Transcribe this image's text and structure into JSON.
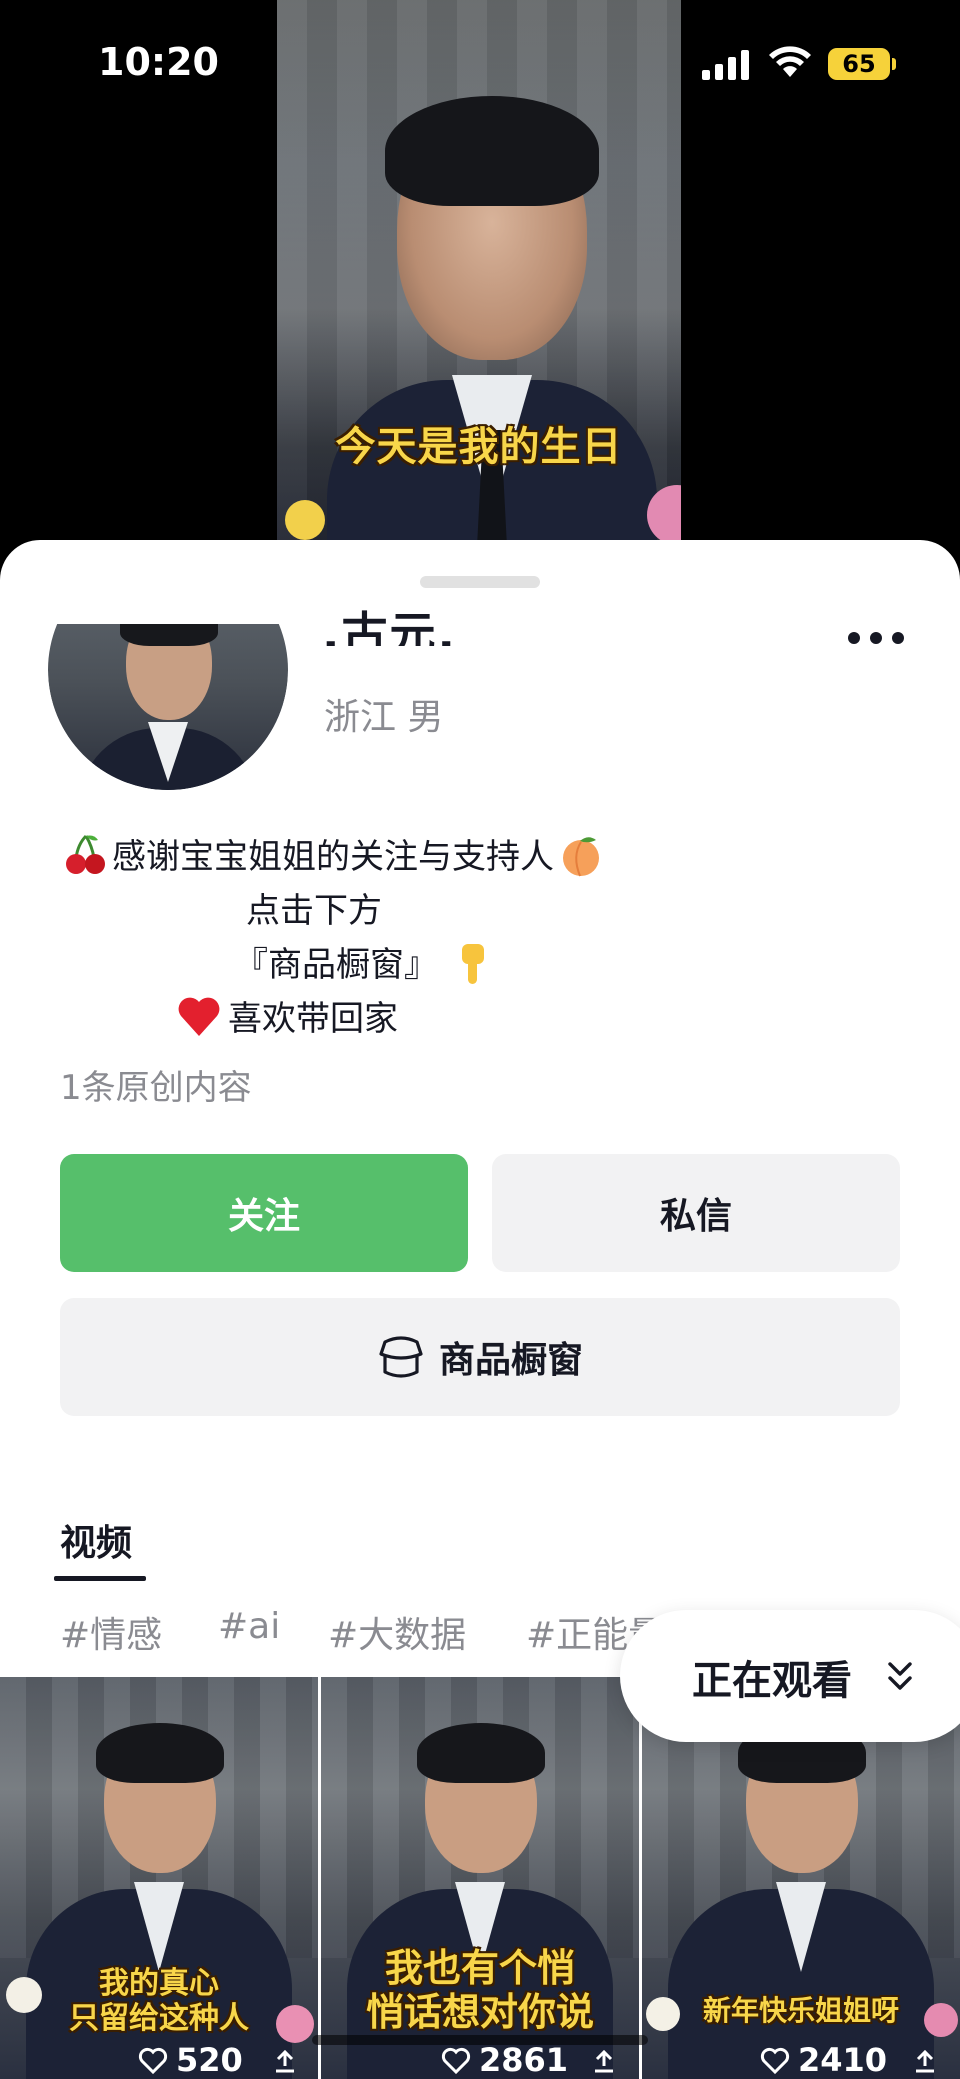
{
  "status_bar": {
    "time": "10:20",
    "battery": "65"
  },
  "video": {
    "caption": "今天是我的生日"
  },
  "profile": {
    "username": ".古元.",
    "location": "浙江  男",
    "bio": {
      "line1": "感谢宝宝姐姐的关注与支持人",
      "line2": "点击下方",
      "line3": "『商品橱窗』",
      "line4": "喜欢带回家"
    },
    "original_count": "1条原创内容"
  },
  "actions": {
    "follow": "关注",
    "message": "私信",
    "shop": "商品橱窗"
  },
  "tabs": {
    "video": "视频"
  },
  "tags": [
    "#情感",
    "#ai",
    "#大数据",
    "#正能量"
  ],
  "watching": {
    "label": "正在观看"
  },
  "videos": [
    {
      "caption_line1": "我的真心",
      "caption_line2": "只留给这种人",
      "likes": "520"
    },
    {
      "caption_line1": "我也有个悄",
      "caption_line2": "悄话想对你说",
      "likes": "2861"
    },
    {
      "caption_line1": "新年快乐姐姐呀",
      "caption_line2": "",
      "likes": "2410"
    }
  ],
  "colors": {
    "accent": "#56bf6b",
    "caption_yellow": "#f8d64a",
    "battery": "#f6d23a"
  },
  "icons": [
    "cellular-signal-icon",
    "wifi-icon",
    "battery-icon",
    "more-icon",
    "cherry-emoji-icon",
    "peach-emoji-icon",
    "pointing-down-emoji-icon",
    "heart-emoji-icon",
    "shop-window-icon",
    "chevron-down-icon",
    "heart-outline-icon",
    "share-icon"
  ]
}
